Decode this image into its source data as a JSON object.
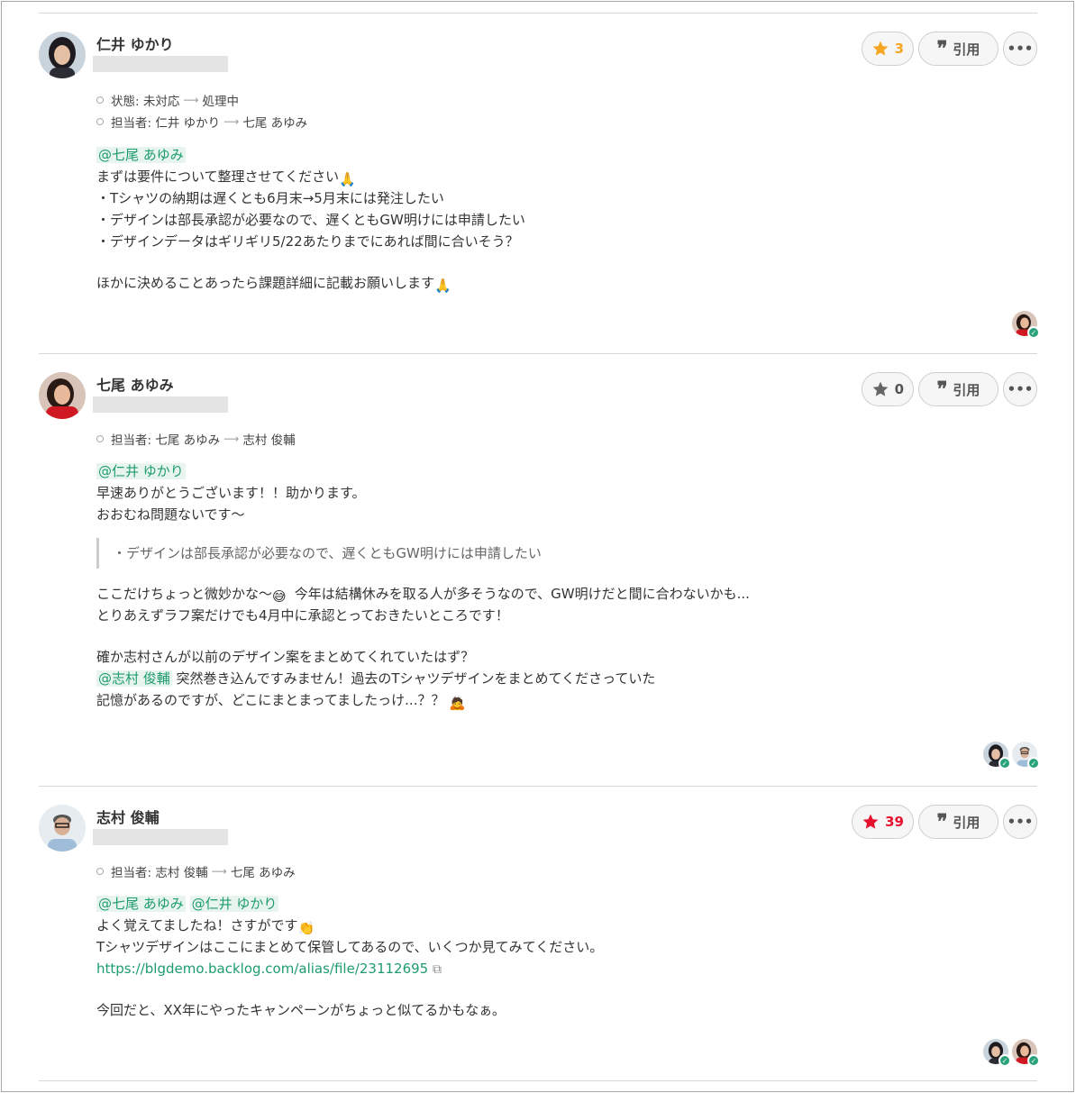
{
  "colors": {
    "accent": "#1e9c6e",
    "star_active": "#f5a623",
    "star_hot": "#e8112d"
  },
  "comments": [
    {
      "author": "仁井 ゆかり",
      "star_count": "3",
      "quote_label": "引用",
      "changes": [
        {
          "label": "状態: 未対応",
          "to": "処理中"
        },
        {
          "label": "担当者: 仁井 ゆかり",
          "to": "七尾 あゆみ"
        }
      ],
      "mention": "@七尾 あゆみ",
      "lines": [
        "まずは要件について整理させてください",
        "・Tシャツの納期は遅くとも6月末→5月末には発注したい",
        "・デザインは部長承認が必要なので、遅くともGW明けには申請したい",
        "・デザインデータはギリギリ5/22あたりまでにあれば間に合いそう？",
        "ほかに決めることあったら課題詳細に記載お願いします"
      ]
    },
    {
      "author": "七尾 あゆみ",
      "star_count": "0",
      "quote_label": "引用",
      "changes": [
        {
          "label": "担当者: 七尾 あゆみ",
          "to": "志村 俊輔"
        }
      ],
      "mention": "@仁井 ゆかり",
      "lines": [
        "早速ありがとうございます！！助かります。",
        "おおむね問題ないです〜",
        "ここだけちょっと微妙かな〜",
        " 今年は結構休みを取る人が多そうなので、GW明けだと間に合わないかも...",
        "とりあえずラフ案だけでも4月中に承認とっておきたいところです！",
        "確か志村さんが以前のデザイン案をまとめてくれていたはず？",
        " 突然巻き込んですみません！過去のTシャツデザインをまとめてくださっていた",
        "記憶があるのですが、どこにまとまってましたっけ...？？"
      ],
      "quote": "・デザインは部長承認が必要なので、遅くともGW明けには申請したい",
      "mention2": "@志村 俊輔"
    },
    {
      "author": "志村 俊輔",
      "star_count": "39",
      "quote_label": "引用",
      "changes": [
        {
          "label": "担当者: 志村 俊輔",
          "to": "七尾 あゆみ"
        }
      ],
      "mention": "@七尾 あゆみ",
      "mention2": "@仁井 ゆかり",
      "lines": [
        "よく覚えてましたね！さすがです",
        "Tシャツデザインはここにまとめて保管してあるので、いくつか見てみてください。",
        "https://blgdemo.backlog.com/alias/file/23112695",
        "今回だと、XX年にやったキャンペーンがちょっと似てるかもなぁ。"
      ]
    }
  ]
}
